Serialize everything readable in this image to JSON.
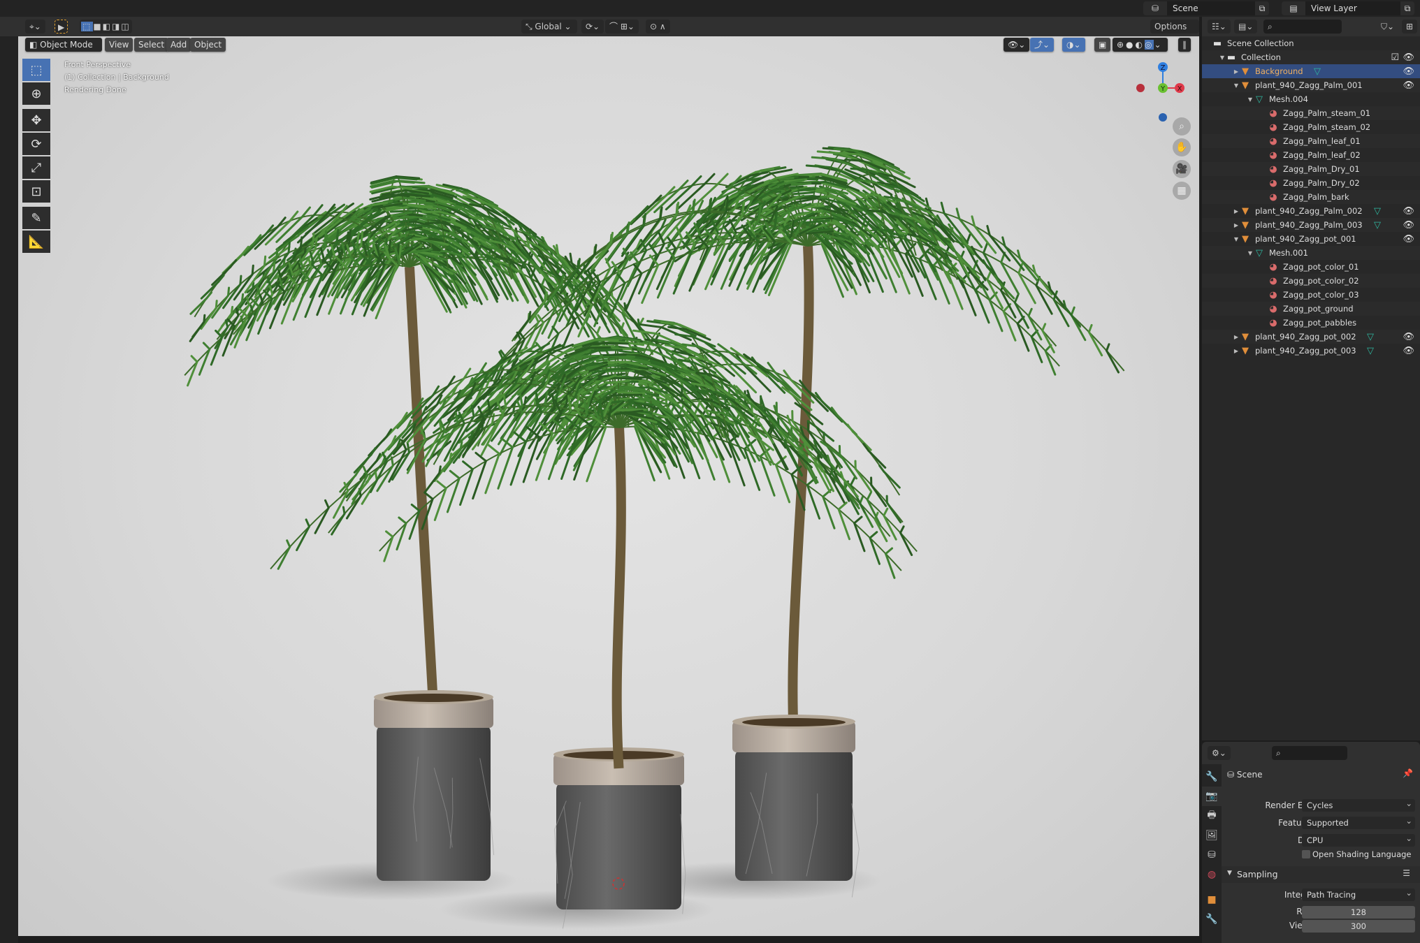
{
  "topbar": {
    "scene": "Scene",
    "view_layer": "View Layer"
  },
  "tool_header": {
    "orientation": "Global",
    "options": "Options"
  },
  "viewport_header": {
    "mode": "Object Mode",
    "menus": [
      "View",
      "Select",
      "Add",
      "Object"
    ]
  },
  "viewport": {
    "overlay_lines": [
      "Front Perspective",
      "(1) Collection | Background",
      "Rendering Done"
    ],
    "gizmo": {
      "z": "Z",
      "y": "Y",
      "x": "X"
    }
  },
  "outliner": {
    "rows": [
      {
        "label": "Scene Collection",
        "depth": 0,
        "type": "scene-collection"
      },
      {
        "label": "Collection",
        "depth": 1,
        "type": "collection",
        "expanded": true
      },
      {
        "label": "Background",
        "depth": 2,
        "type": "object",
        "expanded": false,
        "active": true
      },
      {
        "label": "plant_940_Zagg_Palm_001",
        "depth": 2,
        "type": "object",
        "expanded": true
      },
      {
        "label": "Mesh.004",
        "depth": 3,
        "type": "mesh",
        "expanded": true
      },
      {
        "label": "Zagg_Palm_steam_01",
        "depth": 4,
        "type": "material"
      },
      {
        "label": "Zagg_Palm_steam_02",
        "depth": 4,
        "type": "material"
      },
      {
        "label": "Zagg_Palm_leaf_01",
        "depth": 4,
        "type": "material"
      },
      {
        "label": "Zagg_Palm_leaf_02",
        "depth": 4,
        "type": "material"
      },
      {
        "label": "Zagg_Palm_Dry_01",
        "depth": 4,
        "type": "material"
      },
      {
        "label": "Zagg_Palm_Dry_02",
        "depth": 4,
        "type": "material"
      },
      {
        "label": "Zagg_Palm_bark",
        "depth": 4,
        "type": "material"
      },
      {
        "label": "plant_940_Zagg_Palm_002",
        "depth": 2,
        "type": "object",
        "expanded": false
      },
      {
        "label": "plant_940_Zagg_Palm_003",
        "depth": 2,
        "type": "object",
        "expanded": false
      },
      {
        "label": "plant_940_Zagg_pot_001",
        "depth": 2,
        "type": "object",
        "expanded": true
      },
      {
        "label": "Mesh.001",
        "depth": 3,
        "type": "mesh",
        "expanded": true
      },
      {
        "label": "Zagg_pot_color_01",
        "depth": 4,
        "type": "material"
      },
      {
        "label": "Zagg_pot_color_02",
        "depth": 4,
        "type": "material"
      },
      {
        "label": "Zagg_pot_color_03",
        "depth": 4,
        "type": "material"
      },
      {
        "label": "Zagg_pot_ground",
        "depth": 4,
        "type": "material"
      },
      {
        "label": "Zagg_pot_pabbles",
        "depth": 4,
        "type": "material"
      },
      {
        "label": "plant_940_Zagg_pot_002",
        "depth": 2,
        "type": "object",
        "expanded": false
      },
      {
        "label": "plant_940_Zagg_pot_003",
        "depth": 2,
        "type": "object",
        "expanded": false
      }
    ]
  },
  "properties": {
    "context": "Scene",
    "render_engine": {
      "label": "Render Engine",
      "value": "Cycles"
    },
    "feature_set": {
      "label": "Feature Set",
      "value": "Supported"
    },
    "device": {
      "label": "Device",
      "value": "CPU"
    },
    "osl": {
      "label": "Open Shading Language",
      "checked": false
    },
    "sampling": {
      "title": "Sampling",
      "integrator": {
        "label": "Integrator",
        "value": "Path Tracing"
      },
      "render": {
        "label": "Render",
        "value": "128"
      },
      "viewport": {
        "label": "Viewport",
        "value": "300"
      }
    }
  },
  "colors": {
    "accent": "#4772b3",
    "active_row": "#334d80",
    "object": "#e08e3a",
    "mesh": "#2fb7a0",
    "material": "#d96b6b"
  }
}
